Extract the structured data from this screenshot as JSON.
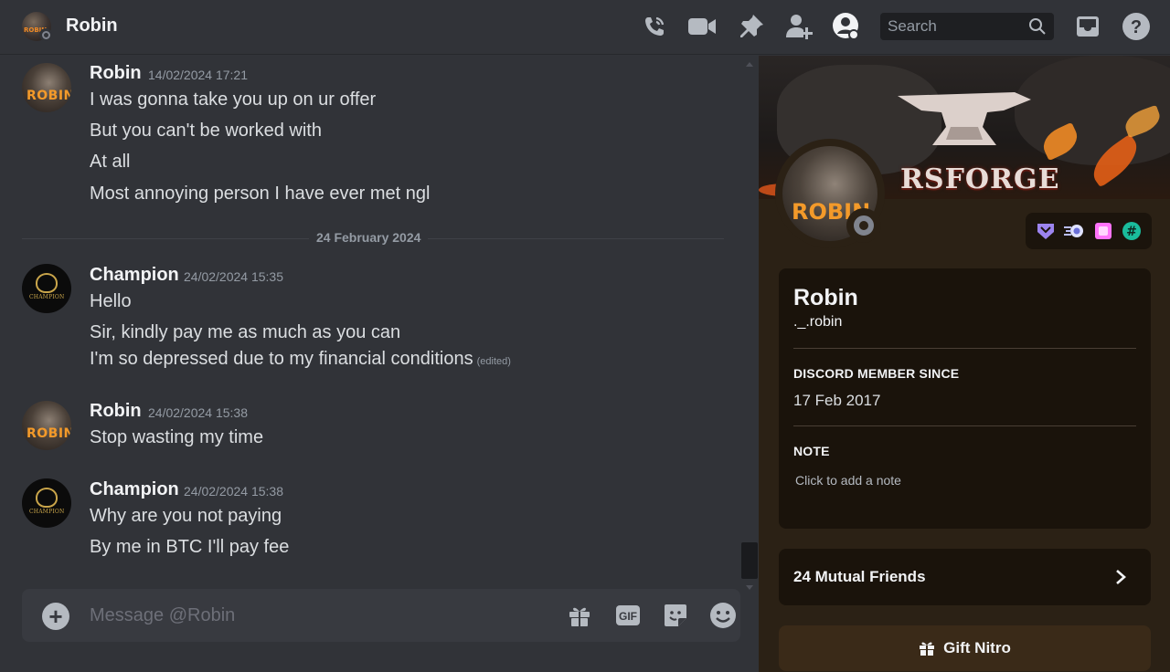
{
  "header": {
    "dm_name": "Robin",
    "search_placeholder": "Search"
  },
  "divider_label": "24 February 2024",
  "messages": [
    {
      "author": "Robin",
      "timestamp": "14/02/2024 17:21",
      "lines": [
        "I was gonna take you up on ur offer",
        "But you can't be worked with",
        "At all",
        "Most annoying person I have ever met ngl"
      ]
    },
    {
      "author": "Champion",
      "timestamp": "24/02/2024 15:35",
      "lines": [
        "Hello",
        "Sir, kindly pay me as much as you can",
        "I'm so depressed due to my financial conditions"
      ],
      "edited_label": "(edited)"
    },
    {
      "author": "Robin",
      "timestamp": "24/02/2024 15:38",
      "lines": [
        "Stop wasting my time"
      ]
    },
    {
      "author": "Champion",
      "timestamp": "24/02/2024 15:38",
      "lines": [
        "Why are you not paying",
        "By me in BTC I'll pay fee"
      ]
    }
  ],
  "avatars": {
    "robin_text": "ROBIN",
    "champion_text": "CHAMPION"
  },
  "composer": {
    "placeholder": "Message @Robin",
    "gif_label": "GIF"
  },
  "profile": {
    "banner_brand": "RSFORGE",
    "display_name": "Robin",
    "username": "._.robin",
    "member_since_heading": "DISCORD MEMBER SINCE",
    "member_since": "17 Feb 2017",
    "note_heading": "NOTE",
    "note_placeholder": "Click to add a note",
    "mutual_friends": "24 Mutual Friends",
    "gift_button": "Gift Nitro"
  },
  "colors": {
    "background": "#313338",
    "panel": "#2b2115",
    "card": "#1a130b",
    "status_offline": "#80848e",
    "accent_orange": "#f39a2a"
  }
}
